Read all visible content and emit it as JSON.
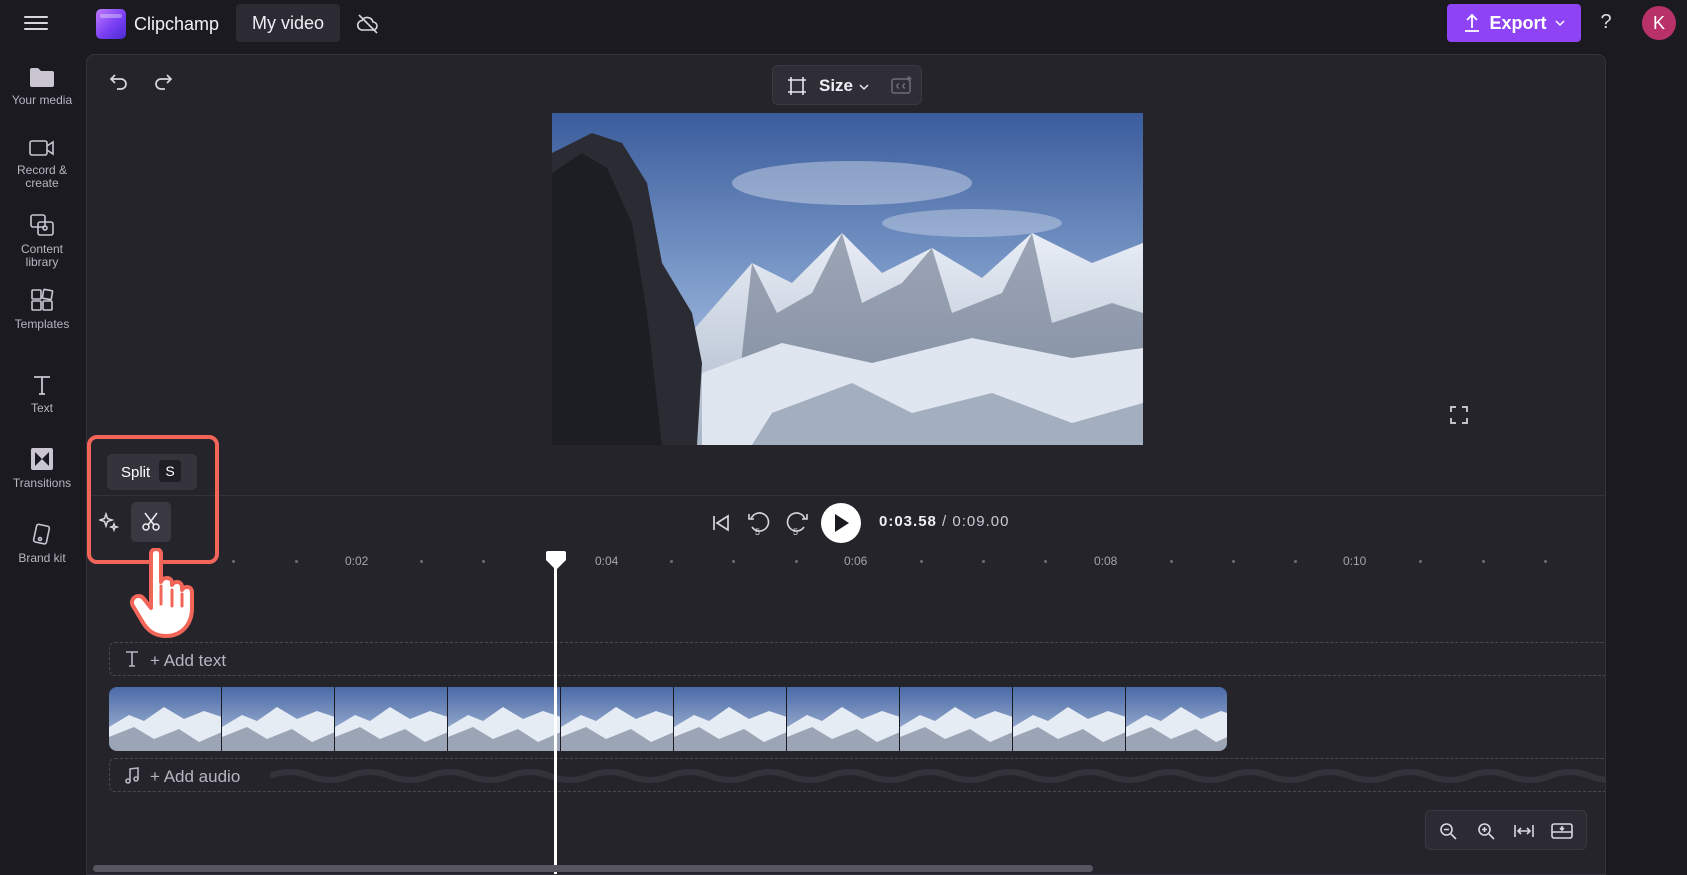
{
  "app": {
    "name": "Clipchamp",
    "project_title": "My video"
  },
  "header": {
    "export_label": "Export",
    "help_label": "?",
    "avatar_initial": "K"
  },
  "sidebar": {
    "items": [
      {
        "label": "Your media",
        "icon": "folder-icon"
      },
      {
        "label": "Record & create",
        "icon": "camera-icon"
      },
      {
        "label": "Content library",
        "icon": "content-library-icon"
      },
      {
        "label": "Templates",
        "icon": "templates-icon"
      },
      {
        "label": "Text",
        "icon": "text-icon"
      },
      {
        "label": "Transitions",
        "icon": "transitions-icon"
      },
      {
        "label": "Brand kit",
        "icon": "brand-kit-icon"
      }
    ]
  },
  "toolbar": {
    "size_label": "Size"
  },
  "tooltip": {
    "label": "Split",
    "shortcut": "S"
  },
  "playback": {
    "current_time": "0:03.58",
    "separator": "/",
    "total_time": "0:09.00",
    "skip_back": "5",
    "skip_forward": "5"
  },
  "timeline": {
    "ticks": [
      "0:02",
      "0:04",
      "0:06",
      "0:08",
      "0:10"
    ],
    "playhead_time_seconds": 3.58,
    "text_track_label": "+ Add text",
    "audio_track_label": "+ Add audio"
  },
  "colors": {
    "accent": "#8e44f5",
    "highlight": "#f2665a",
    "avatar": "#b83269"
  }
}
